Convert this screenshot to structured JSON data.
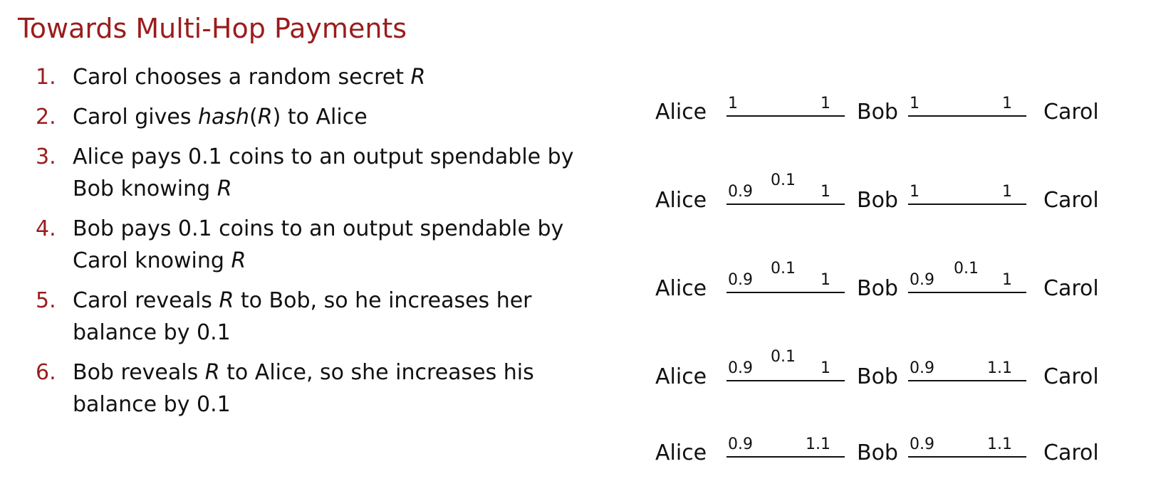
{
  "title": "Towards Multi-Hop Payments",
  "steps": [
    {
      "num": "1.",
      "parts": [
        "Carol chooses a random secret ",
        "R",
        ""
      ]
    },
    {
      "num": "2.",
      "parts": [
        "Carol gives ",
        "hash",
        "(",
        "R",
        ") to Alice"
      ]
    },
    {
      "num": "3.",
      "parts": [
        "Alice pays 0.1 coins to an output spendable by Bob knowing ",
        "R",
        ""
      ]
    },
    {
      "num": "4.",
      "parts": [
        "Bob pays 0.1 coins to an output spendable by Carol knowing ",
        "R",
        ""
      ]
    },
    {
      "num": "5.",
      "parts": [
        "Carol reveals ",
        "R",
        " to Bob, so he increases her balance by 0.1"
      ]
    },
    {
      "num": "6.",
      "parts": [
        "Bob reveals ",
        "R",
        " to Alice, so she increases his balance by 0.1"
      ]
    }
  ],
  "parties": {
    "alice": "Alice",
    "bob": "Bob",
    "carol": "Carol"
  },
  "rows": [
    {
      "ab": {
        "left": "1",
        "mid": "",
        "right": "1"
      },
      "bc": {
        "left": "1",
        "mid": "",
        "right": "1"
      }
    },
    {
      "ab": {
        "left": "0.9",
        "mid": "0.1",
        "right": "1"
      },
      "bc": {
        "left": "1",
        "mid": "",
        "right": "1"
      }
    },
    {
      "ab": {
        "left": "0.9",
        "mid": "0.1",
        "right": "1"
      },
      "bc": {
        "left": "0.9",
        "mid": "0.1",
        "right": "1"
      }
    },
    {
      "ab": {
        "left": "0.9",
        "mid": "0.1",
        "right": "1"
      },
      "bc": {
        "left": "0.9",
        "mid": "",
        "right": "1.1"
      }
    },
    {
      "ab": {
        "left": "0.9",
        "mid": "",
        "right": "1.1"
      },
      "bc": {
        "left": "0.9",
        "mid": "",
        "right": "1.1"
      }
    }
  ]
}
